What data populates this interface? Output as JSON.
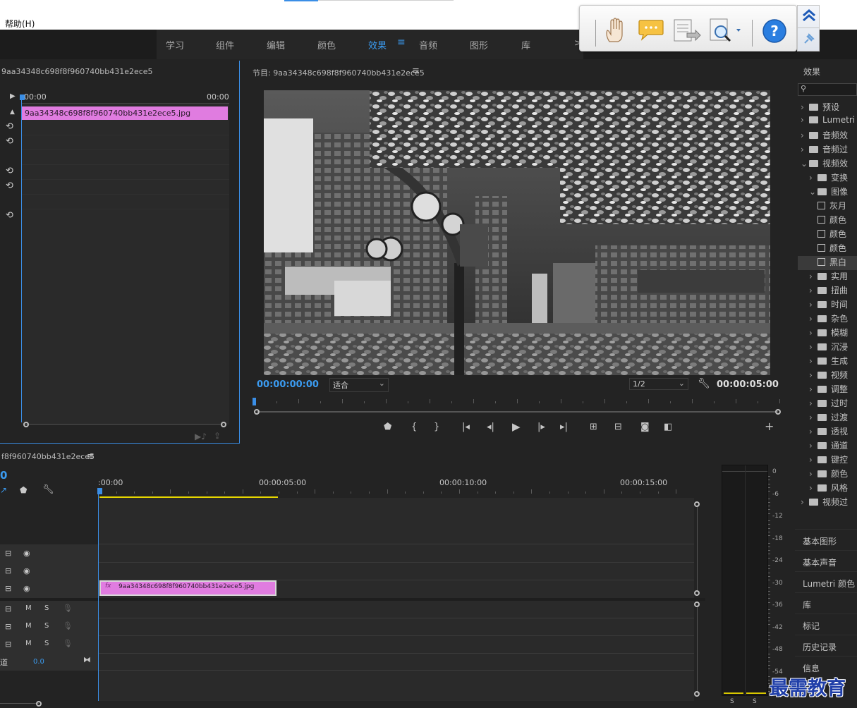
{
  "menu": {
    "help": "帮助(H)"
  },
  "workspaces": {
    "tabs": [
      "学习",
      "组件",
      "编辑",
      "颜色",
      "效果",
      "音频",
      "图形",
      "库"
    ],
    "active": "效果",
    "more": ">>"
  },
  "float_toolbar": {
    "icons": [
      "hand-icon",
      "comment-icon",
      "document-export-icon",
      "search-zoom-icon",
      "help-icon",
      "collapse-up-icon",
      "pin-icon"
    ],
    "help_label": "?"
  },
  "source": {
    "title": "9aa34348c698f8f960740bb431e2ece5",
    "tc_start": "00:00",
    "tc_end": "00:00",
    "clip_name": "9aa34348c698f8f960740bb431e2ece5.jpg"
  },
  "program": {
    "title": "节目: 9aa34348c698f8f960740bb431e2ece5",
    "timecode": "00:00:00:00",
    "fit": "适合",
    "resolution": "1/2",
    "duration": "00:00:05:00",
    "add": "+"
  },
  "effects": {
    "title": "效果",
    "search_icon": "search-icon",
    "items": [
      {
        "label": "预设",
        "indent": 0,
        "open": false,
        "type": "folder"
      },
      {
        "label": "Lumetri",
        "indent": 0,
        "open": false,
        "type": "folder"
      },
      {
        "label": "音频效",
        "indent": 0,
        "open": false,
        "type": "folder"
      },
      {
        "label": "音频过",
        "indent": 0,
        "open": false,
        "type": "folder"
      },
      {
        "label": "视频效",
        "indent": 0,
        "open": true,
        "type": "folder"
      },
      {
        "label": "变换",
        "indent": 1,
        "open": false,
        "type": "folder"
      },
      {
        "label": "图像",
        "indent": 1,
        "open": true,
        "type": "folder"
      },
      {
        "label": "灰月",
        "indent": 2,
        "type": "effect"
      },
      {
        "label": "颜色",
        "indent": 2,
        "type": "effect"
      },
      {
        "label": "颜色",
        "indent": 2,
        "type": "effect"
      },
      {
        "label": "颜色",
        "indent": 2,
        "type": "effect"
      },
      {
        "label": "黑白",
        "indent": 2,
        "type": "effect",
        "selected": true
      },
      {
        "label": "实用",
        "indent": 1,
        "open": false,
        "type": "folder"
      },
      {
        "label": "扭曲",
        "indent": 1,
        "open": false,
        "type": "folder"
      },
      {
        "label": "时间",
        "indent": 1,
        "open": false,
        "type": "folder"
      },
      {
        "label": "杂色",
        "indent": 1,
        "open": false,
        "type": "folder"
      },
      {
        "label": "模糊",
        "indent": 1,
        "open": false,
        "type": "folder"
      },
      {
        "label": "沉浸",
        "indent": 1,
        "open": false,
        "type": "folder"
      },
      {
        "label": "生成",
        "indent": 1,
        "open": false,
        "type": "folder"
      },
      {
        "label": "视频",
        "indent": 1,
        "open": false,
        "type": "folder"
      },
      {
        "label": "调整",
        "indent": 1,
        "open": false,
        "type": "folder"
      },
      {
        "label": "过时",
        "indent": 1,
        "open": false,
        "type": "folder"
      },
      {
        "label": "过渡",
        "indent": 1,
        "open": false,
        "type": "folder"
      },
      {
        "label": "透视",
        "indent": 1,
        "open": false,
        "type": "folder"
      },
      {
        "label": "通道",
        "indent": 1,
        "open": false,
        "type": "folder"
      },
      {
        "label": "键控",
        "indent": 1,
        "open": false,
        "type": "folder"
      },
      {
        "label": "颜色",
        "indent": 1,
        "open": false,
        "type": "folder"
      },
      {
        "label": "风格",
        "indent": 1,
        "open": false,
        "type": "folder"
      },
      {
        "label": "视频过",
        "indent": 0,
        "open": false,
        "type": "folder"
      }
    ]
  },
  "side_panels": [
    "基本图形",
    "基本声音",
    "Lumetri 颜色",
    "库",
    "标记",
    "历史记录",
    "信息"
  ],
  "timeline": {
    "title": "f8f960740bb431e2ece5",
    "timecode": "0",
    "ruler": [
      ":00:00",
      "00:00:05:00",
      "00:00:10:00",
      "00:00:15:00"
    ],
    "clip_name": "9aa34348c698f8f960740bb431e2ece5.jpg",
    "fx_badge": "fx",
    "audio_m": "M",
    "audio_s": "S",
    "master_label": "道",
    "master_value": "0.0"
  },
  "meter": {
    "labels": [
      "0",
      "-6",
      "-12",
      "-18",
      "-24",
      "-30",
      "-36",
      "-42",
      "-48",
      "-54"
    ],
    "solo": [
      "S",
      "S"
    ]
  },
  "watermark": "最需教育",
  "colors": {
    "accent": "#3b9bf0",
    "clip": "#e07ce0",
    "panel": "#232323",
    "work_area": "#e6d600"
  }
}
